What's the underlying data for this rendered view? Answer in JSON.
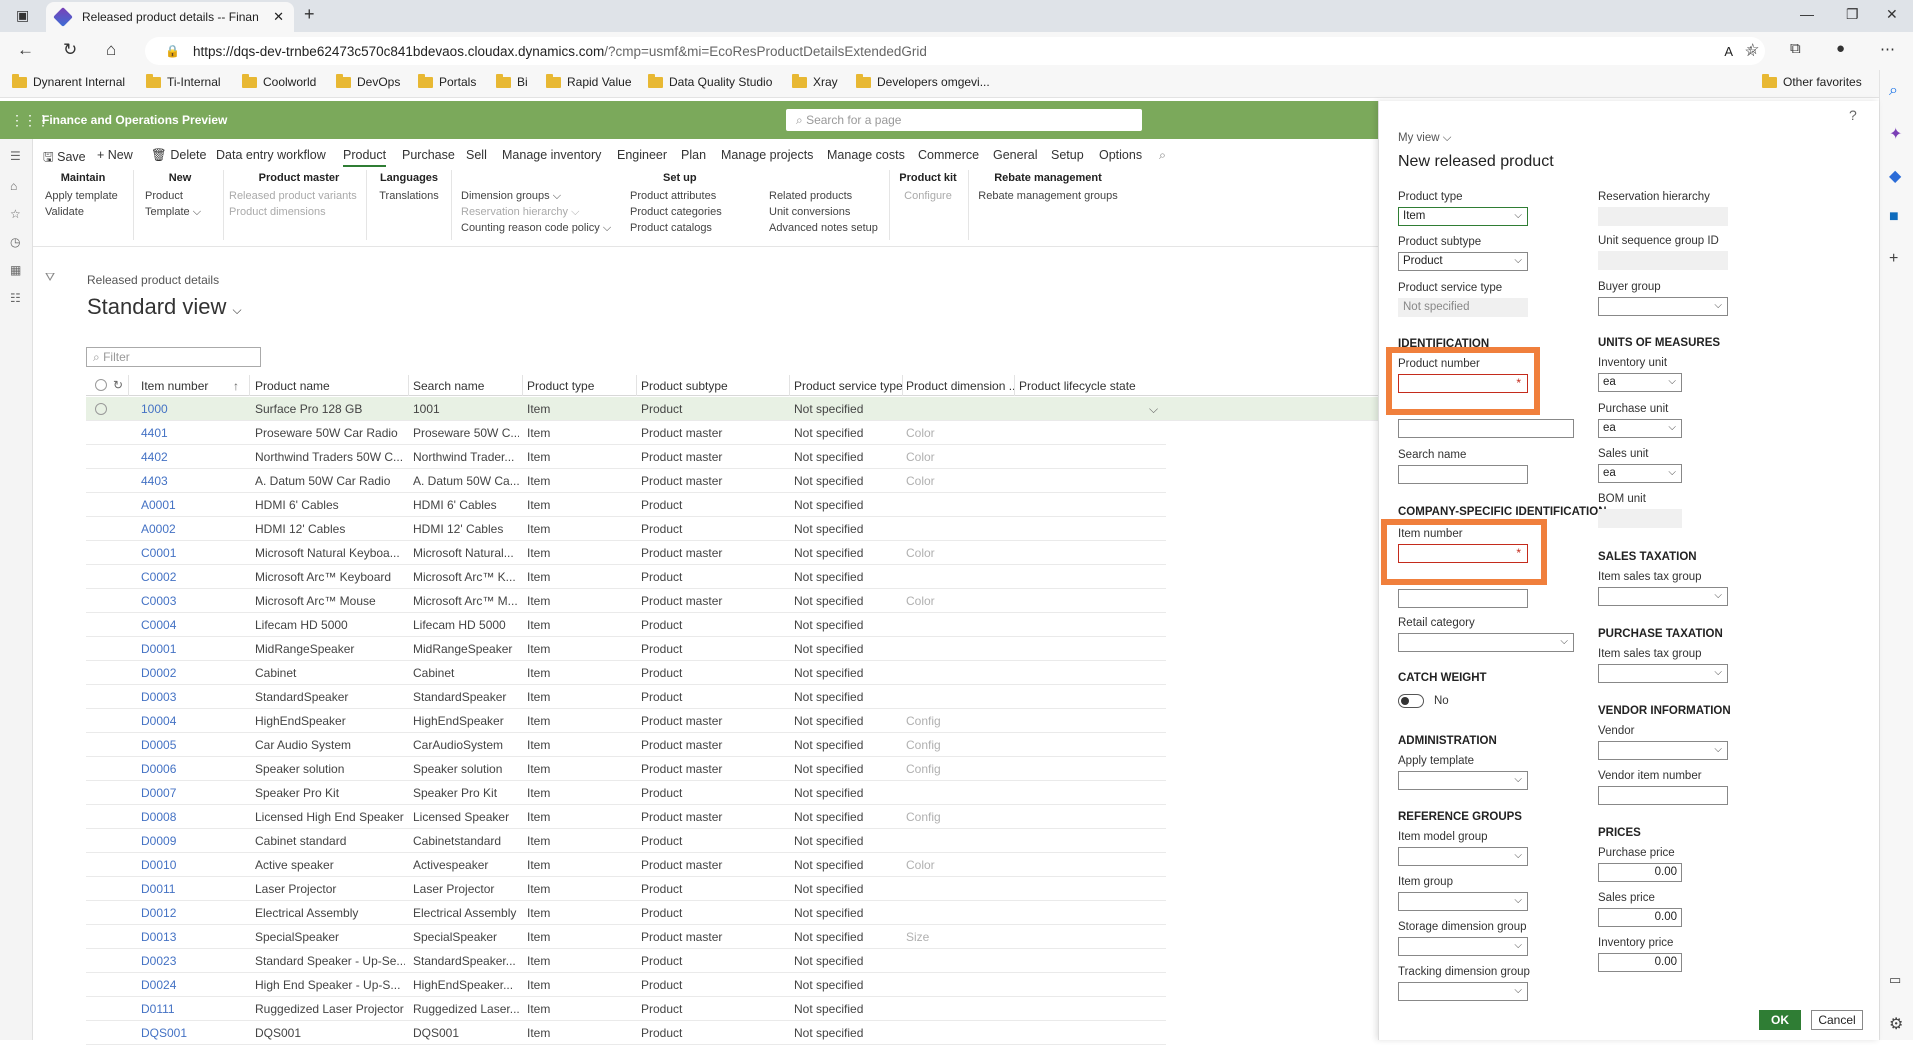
{
  "browser": {
    "tab_title": "Released product details -- Finan",
    "url_main": "https://dqs-dev-trnbe62473c570c841bdevaos.cloudax.dynamics.com",
    "url_rest": "/?cmp=usmf&mi=EcoResProductDetailsExtendedGrid",
    "favorites": [
      "Dynarent Internal",
      "Ti-Internal",
      "Coolworld",
      "DevOps",
      "Portals",
      "Bi",
      "Rapid Value",
      "Data Quality Studio",
      "Xray",
      "Developers omgevi..."
    ],
    "other_favorites": "Other favorites"
  },
  "app": {
    "title": "Finance and Operations Preview",
    "search_placeholder": "Search for a page"
  },
  "actions": {
    "save": "Save",
    "new": "New",
    "delete": "Delete",
    "items": [
      "Data entry workflow",
      "Product",
      "Purchase",
      "Sell",
      "Manage inventory",
      "Engineer",
      "Plan",
      "Manage projects",
      "Manage costs",
      "Commerce",
      "General",
      "Setup",
      "Options"
    ]
  },
  "ribbon": {
    "maintain": {
      "h": "Maintain",
      "a": "Apply template",
      "b": "Validate"
    },
    "new": {
      "h": "New",
      "a": "Product",
      "b": "Template"
    },
    "master": {
      "h": "Product master",
      "a": "Released product variants",
      "b": "Product dimensions"
    },
    "lang": {
      "h": "Languages",
      "a": "Translations"
    },
    "setup": {
      "h": "Set up",
      "a": "Dimension groups",
      "b": "Reservation hierarchy",
      "c": "Counting reason code policy",
      "d": "Product attributes",
      "e": "Product categories",
      "f": "Product catalogs",
      "g": "Related products",
      "h2": "Unit conversions",
      "i": "Advanced notes setup"
    },
    "kit": {
      "h": "Product kit",
      "a": "Configure"
    },
    "rebate": {
      "h": "Rebate management",
      "a": "Rebate management groups"
    }
  },
  "page": {
    "breadcrumb": "Released product details",
    "view": "Standard view",
    "filter_placeholder": "Filter"
  },
  "grid": {
    "columns": [
      "Item number",
      "Product name",
      "Search name",
      "Product type",
      "Product subtype",
      "Product service type",
      "Product dimension ...",
      "Product lifecycle state"
    ],
    "rows": [
      [
        "1000",
        "Surface Pro 128 GB",
        "1001",
        "Item",
        "Product",
        "Not specified",
        ""
      ],
      [
        "4401",
        "Proseware 50W Car Radio",
        "Proseware 50W C...",
        "Item",
        "Product master",
        "Not specified",
        "Color"
      ],
      [
        "4402",
        "Northwind Traders 50W C...",
        "Northwind Trader...",
        "Item",
        "Product master",
        "Not specified",
        "Color"
      ],
      [
        "4403",
        "A. Datum 50W Car Radio",
        "A. Datum 50W Ca...",
        "Item",
        "Product master",
        "Not specified",
        "Color"
      ],
      [
        "A0001",
        "HDMI 6' Cables",
        "HDMI 6' Cables",
        "Item",
        "Product",
        "Not specified",
        ""
      ],
      [
        "A0002",
        "HDMI 12' Cables",
        "HDMI 12' Cables",
        "Item",
        "Product",
        "Not specified",
        ""
      ],
      [
        "C0001",
        "Microsoft Natural Keyboa...",
        "Microsoft Natural...",
        "Item",
        "Product master",
        "Not specified",
        "Color"
      ],
      [
        "C0002",
        "Microsoft Arc™ Keyboard",
        "Microsoft Arc™ K...",
        "Item",
        "Product",
        "Not specified",
        ""
      ],
      [
        "C0003",
        "Microsoft Arc™ Mouse",
        "Microsoft Arc™ M...",
        "Item",
        "Product master",
        "Not specified",
        "Color"
      ],
      [
        "C0004",
        "Lifecam HD 5000",
        "Lifecam HD 5000",
        "Item",
        "Product",
        "Not specified",
        ""
      ],
      [
        "D0001",
        "MidRangeSpeaker",
        "MidRangeSpeaker",
        "Item",
        "Product",
        "Not specified",
        ""
      ],
      [
        "D0002",
        "Cabinet",
        "Cabinet",
        "Item",
        "Product",
        "Not specified",
        ""
      ],
      [
        "D0003",
        "StandardSpeaker",
        "StandardSpeaker",
        "Item",
        "Product",
        "Not specified",
        ""
      ],
      [
        "D0004",
        "HighEndSpeaker",
        "HighEndSpeaker",
        "Item",
        "Product master",
        "Not specified",
        "Config"
      ],
      [
        "D0005",
        "Car Audio System",
        "CarAudioSystem",
        "Item",
        "Product master",
        "Not specified",
        "Config"
      ],
      [
        "D0006",
        "Speaker solution",
        "Speaker solution",
        "Item",
        "Product master",
        "Not specified",
        "Config"
      ],
      [
        "D0007",
        "Speaker Pro Kit",
        "Speaker Pro Kit",
        "Item",
        "Product",
        "Not specified",
        ""
      ],
      [
        "D0008",
        "Licensed High End Speaker",
        "Licensed Speaker",
        "Item",
        "Product master",
        "Not specified",
        "Config"
      ],
      [
        "D0009",
        "Cabinet standard",
        "Cabinetstandard",
        "Item",
        "Product",
        "Not specified",
        ""
      ],
      [
        "D0010",
        "Active speaker",
        "Activespeaker",
        "Item",
        "Product master",
        "Not specified",
        "Color"
      ],
      [
        "D0011",
        "Laser Projector",
        "Laser Projector",
        "Item",
        "Product",
        "Not specified",
        ""
      ],
      [
        "D0012",
        "Electrical Assembly",
        "Electrical Assembly",
        "Item",
        "Product",
        "Not specified",
        ""
      ],
      [
        "D0013",
        "SpecialSpeaker",
        "SpecialSpeaker",
        "Item",
        "Product master",
        "Not specified",
        "Size"
      ],
      [
        "D0023",
        "Standard Speaker - Up-Se...",
        "StandardSpeaker...",
        "Item",
        "Product",
        "Not specified",
        ""
      ],
      [
        "D0024",
        "High End Speaker - Up-S...",
        "HighEndSpeaker...",
        "Item",
        "Product",
        "Not specified",
        ""
      ],
      [
        "D0111",
        "Ruggedized Laser Projector",
        "Ruggedized Laser...",
        "Item",
        "Product",
        "Not specified",
        ""
      ],
      [
        "DQS001",
        "DQS001",
        "DQS001",
        "Item",
        "Product",
        "Not specified",
        ""
      ]
    ]
  },
  "panel": {
    "my_view": "My view",
    "title": "New released product",
    "product_type": {
      "label": "Product type",
      "value": "Item"
    },
    "product_subtype": {
      "label": "Product subtype",
      "value": "Product"
    },
    "product_service_type": {
      "label": "Product service type",
      "value": "Not specified"
    },
    "reservation_hierarchy": "Reservation hierarchy",
    "unit_sequence": "Unit sequence group ID",
    "buyer_group": "Buyer group",
    "identification": "IDENTIFICATION",
    "product_number": "Product number",
    "search_name": "Search name",
    "company_id": "COMPANY-SPECIFIC IDENTIFICATION",
    "item_number": "Item number",
    "retail_category": "Retail category",
    "catch_weight": "CATCH WEIGHT",
    "catch_value": "No",
    "administration": "ADMINISTRATION",
    "apply_template": "Apply template",
    "reference_groups": "REFERENCE GROUPS",
    "item_model_group": "Item model group",
    "item_group": "Item group",
    "storage_dim": "Storage dimension group",
    "tracking_dim": "Tracking dimension group",
    "units": "UNITS OF MEASURES",
    "inventory_unit": "Inventory unit",
    "purchase_unit": "Purchase unit",
    "sales_unit": "Sales unit",
    "bom_unit": "BOM unit",
    "unit_value": "ea",
    "sales_tax": "SALES TAXATION",
    "item_sales_tax_group": "Item sales tax group",
    "purchase_tax": "PURCHASE TAXATION",
    "vendor_info": "VENDOR INFORMATION",
    "vendor": "Vendor",
    "vendor_item_number": "Vendor item number",
    "prices": "PRICES",
    "purchase_price": "Purchase price",
    "sales_price": "Sales price",
    "inventory_price": "Inventory price",
    "price_value": "0.00",
    "ok": "OK",
    "cancel": "Cancel"
  },
  "colors": {
    "appbar": "#7ba95b",
    "accent": "#2f7d34",
    "link": "#4472c4",
    "highlight": "#f07f3c"
  }
}
